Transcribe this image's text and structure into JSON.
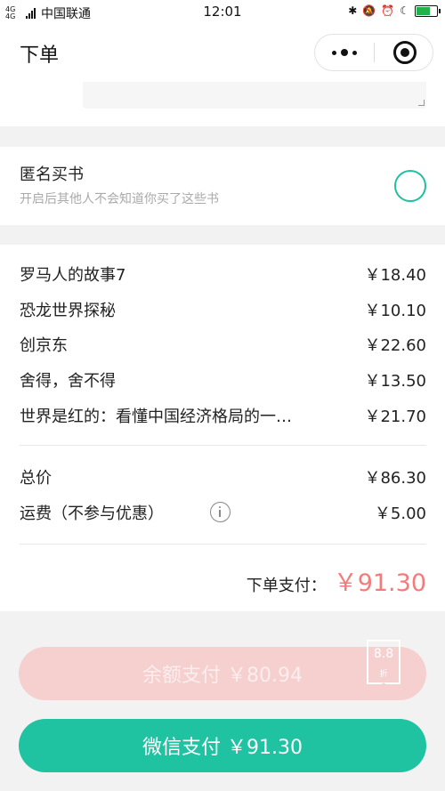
{
  "status_bar": {
    "network": "4G 4G",
    "carrier": "中国联通",
    "time": "12:01"
  },
  "nav": {
    "title": "下单"
  },
  "anonymous": {
    "title": "匿名买书",
    "subtitle": "开启后其他人不会知道你买了这些书"
  },
  "order": {
    "items": [
      {
        "name": "罗马人的故事7",
        "price": "￥18.40"
      },
      {
        "name": "恐龙世界探秘",
        "price": "￥10.10"
      },
      {
        "name": "创京东",
        "price": "￥22.60"
      },
      {
        "name": "舍得，舍不得",
        "price": "￥13.50"
      },
      {
        "name": "世界是红的：看懂中国经济格局的一…",
        "price": "￥21.70"
      }
    ],
    "total_label": "总价",
    "total_value": "￥86.30",
    "shipping_label": "运费（不参与优惠）",
    "shipping_value": "￥5.00",
    "pay_label": "下单支付：",
    "pay_value": "￥91.30"
  },
  "buttons": {
    "balance_label": "余额支付 ￥80.94",
    "discount_badge": "8.8",
    "discount_unit": "折",
    "wechat_label": "微信支付 ￥91.30"
  },
  "colors": {
    "accent": "#1fc3a1",
    "price_highlight": "#f27b7b",
    "balance_button": "#f6cfcf"
  },
  "battery_level": 0.7
}
